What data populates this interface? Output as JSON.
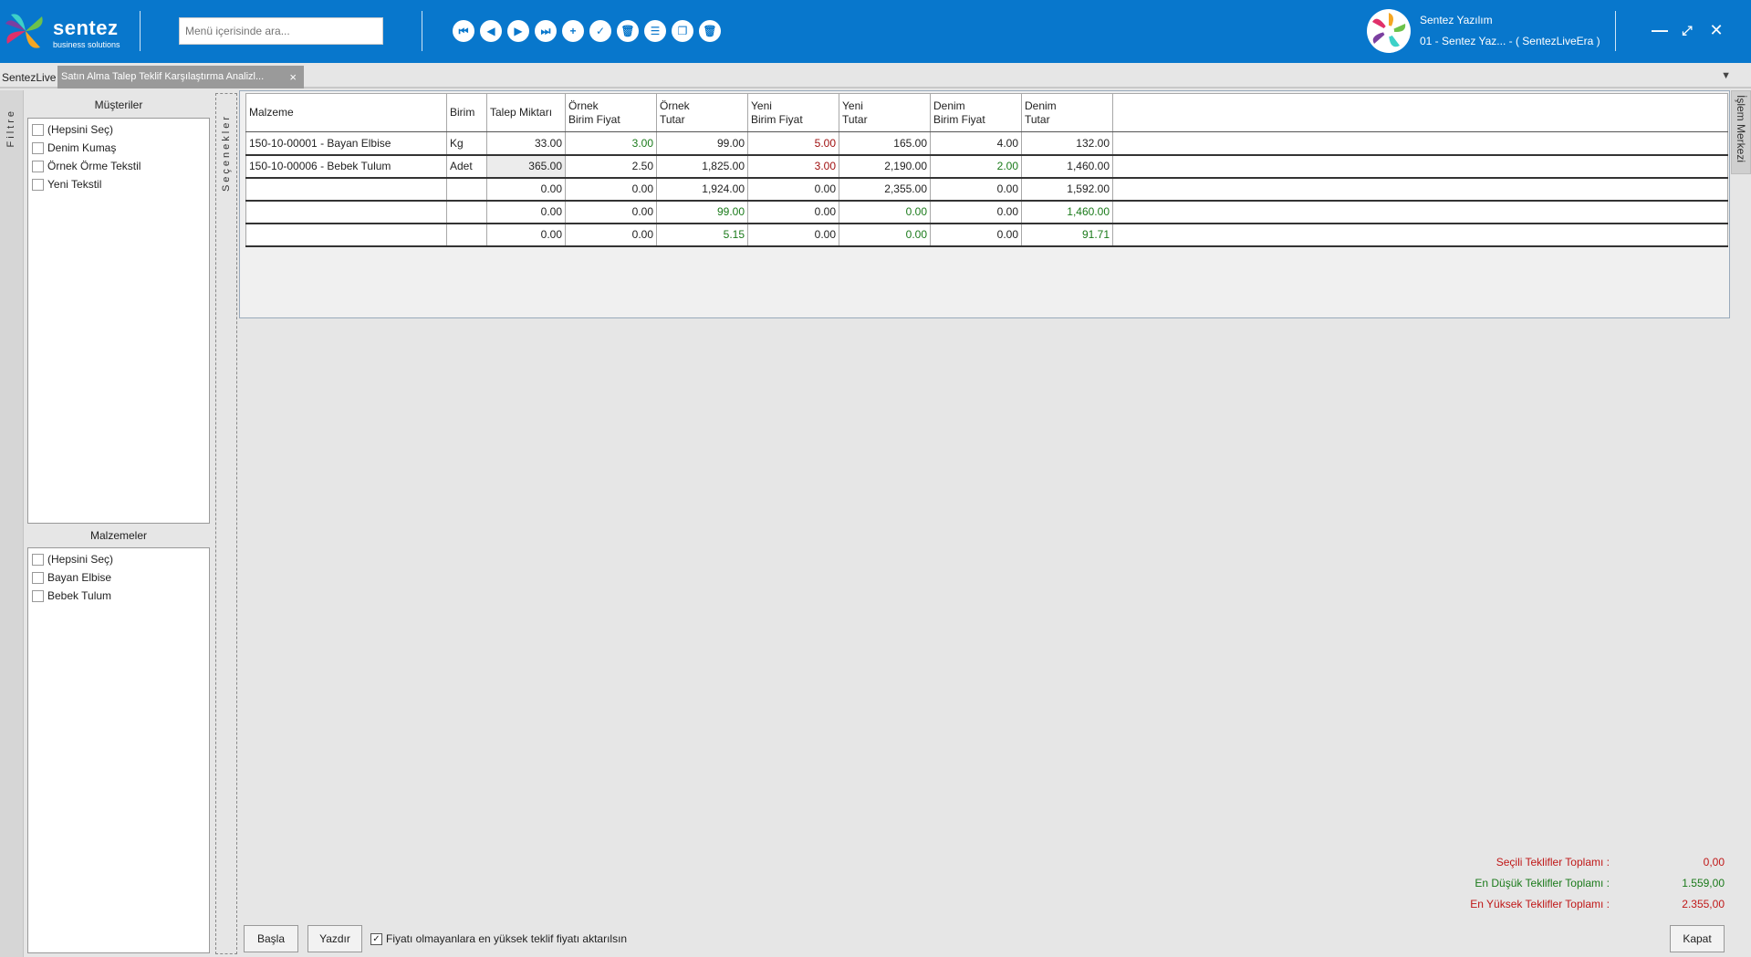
{
  "app": {
    "logo_text": "sentez",
    "logo_sub": "business solutions",
    "search_placeholder": "Menü içerisinde ara...",
    "user_name": "Sentez Yazılım",
    "company": "01 - Sentez Yaz... - ( SentezLiveEra )"
  },
  "colors": {
    "topbar": "#0877cc",
    "positive": "#1a7a1a",
    "negative": "#a01010"
  },
  "toolbar": [
    {
      "name": "first-record-icon",
      "glyph": "⏮"
    },
    {
      "name": "previous-record-icon",
      "glyph": "◀"
    },
    {
      "name": "next-record-icon",
      "glyph": "▶"
    },
    {
      "name": "last-record-icon",
      "glyph": "⏭"
    },
    {
      "name": "add-icon",
      "glyph": "+"
    },
    {
      "name": "save-icon",
      "glyph": "✓"
    },
    {
      "name": "delete-icon",
      "glyph": "🗑"
    },
    {
      "name": "list-icon",
      "glyph": "☰"
    },
    {
      "name": "window-icon",
      "glyph": "❐"
    },
    {
      "name": "trash-icon",
      "glyph": "🗑"
    }
  ],
  "tabs": {
    "home": "SentezLive",
    "active": "Satın Alma Talep Teklif Karşılaştırma Analizl...",
    "close_glyph": "×"
  },
  "side": {
    "filter_label": "Filtre",
    "options_label": "Seçenekler",
    "islem_label": "İşlem Merkezi",
    "customers_title": "Müşteriler",
    "customers": [
      "(Hepsini Seç)",
      "Denim Kumaş",
      "Örnek Örme Tekstil",
      "Yeni Tekstil"
    ],
    "materials_title": "Malzemeler",
    "materials": [
      "(Hepsini Seç)",
      "Bayan Elbise",
      "Bebek Tulum"
    ]
  },
  "grid": {
    "headers": [
      "Malzeme",
      "Birim",
      "Talep Miktarı",
      "Örnek\nBirim Fiyat",
      "Örnek\nTutar",
      "Yeni\nBirim Fiyat",
      "Yeni\nTutar",
      "Denim\nBirim Fiyat",
      "Denim\nTutar"
    ],
    "rows": [
      {
        "cells": [
          "150-10-00001 - Bayan Elbise",
          "Kg",
          "33.00",
          "3.00",
          "99.00",
          "5.00",
          "165.00",
          "4.00",
          "132.00"
        ],
        "styles": [
          "",
          "",
          "",
          "green",
          "",
          "red",
          "",
          "",
          ""
        ]
      },
      {
        "cells": [
          "150-10-00006 - Bebek Tulum",
          "Adet",
          "365.00",
          "2.50",
          "1,825.00",
          "3.00",
          "2,190.00",
          "2.00",
          "1,460.00"
        ],
        "styles": [
          "",
          "",
          "shade",
          "",
          "",
          "red",
          "",
          "green",
          ""
        ]
      },
      {
        "cells": [
          "",
          "",
          "0.00",
          "0.00",
          "1,924.00",
          "0.00",
          "2,355.00",
          "0.00",
          "1,592.00"
        ],
        "styles": [
          "",
          "",
          "",
          "",
          "",
          "",
          "",
          "",
          ""
        ]
      },
      {
        "cells": [
          "",
          "",
          "0.00",
          "0.00",
          "99.00",
          "0.00",
          "0.00",
          "0.00",
          "1,460.00"
        ],
        "styles": [
          "",
          "",
          "",
          "",
          "green",
          "",
          "green",
          "",
          "green"
        ]
      },
      {
        "cells": [
          "",
          "",
          "0.00",
          "0.00",
          "5.15",
          "0.00",
          "0.00",
          "0.00",
          "91.71"
        ],
        "styles": [
          "",
          "",
          "",
          "",
          "green",
          "",
          "green",
          "",
          "green"
        ]
      }
    ]
  },
  "footer": {
    "start_button": "Başla",
    "print_button": "Yazdır",
    "checkbox_label": "Fiyatı olmayanlara en yüksek teklif fiyatı aktarılsın",
    "checkbox_checked": "✓",
    "close_button": "Kapat",
    "sum_selected_label": "Seçili Teklifler Toplamı :",
    "sum_selected_value": "0,00",
    "sum_min_label": "En Düşük Teklifler Toplamı :",
    "sum_min_value": "1.559,00",
    "sum_max_label": "En Yüksek Teklifler Toplamı :",
    "sum_max_value": "2.355,00"
  }
}
